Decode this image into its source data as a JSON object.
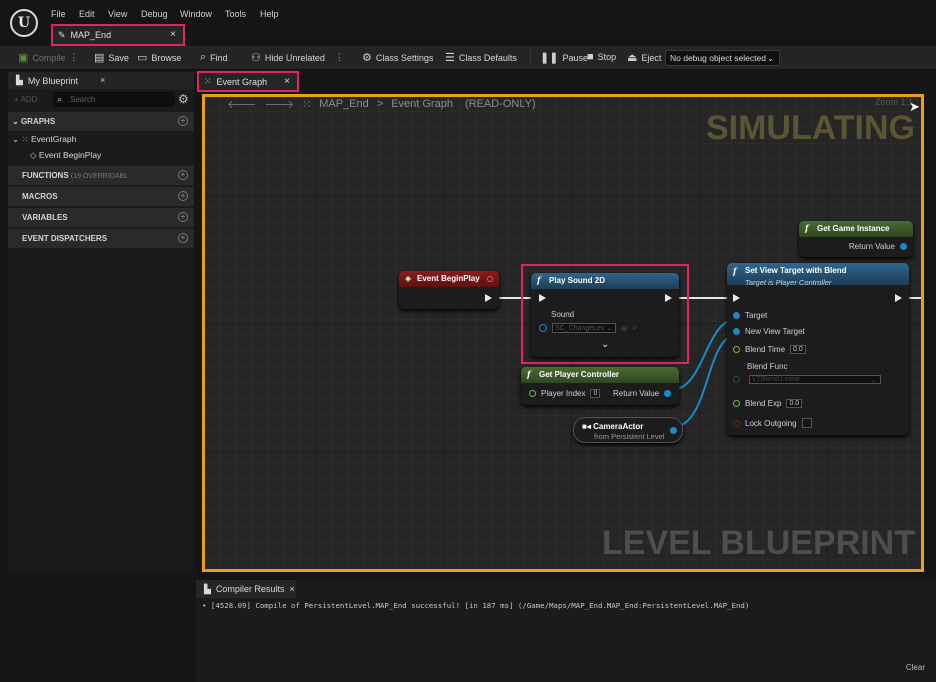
{
  "menu": [
    "File",
    "Edit",
    "View",
    "Debug",
    "Window",
    "Tools",
    "Help"
  ],
  "doc_tab": {
    "label": "MAP_End",
    "close": "×"
  },
  "toolbar": {
    "compile": "Compile",
    "save": "Save",
    "browse": "Browse",
    "find": "Find",
    "hide_unrelated": "Hide Unrelated",
    "class_settings": "Class Settings",
    "class_defaults": "Class Defaults",
    "pause": "Pause",
    "stop": "Stop",
    "eject": "Eject",
    "debug_select": "No debug object selected"
  },
  "left_panel": {
    "tab_label": "My Blueprint",
    "tab_close": "×",
    "add": "+ ADD",
    "search_placeholder": "Search",
    "sections": {
      "graphs": "GRAPHS",
      "functions": "FUNCTIONS",
      "functions_sub": "(19 OVERRIDABL",
      "macros": "MACROS",
      "variables": "VARIABLES",
      "dispatchers": "EVENT DISPATCHERS"
    },
    "tree": {
      "event_graph": "EventGraph",
      "event_begin_play": "Event BeginPlay"
    }
  },
  "graph_tab": {
    "label": "Event Graph",
    "close": "×"
  },
  "graph": {
    "breadcrumb_root": "MAP_End",
    "breadcrumb_sep": ">",
    "breadcrumb_graph": "Event Graph",
    "read_only": "(READ-ONLY)",
    "zoom": "Zoom 1:1",
    "watermark_top": "SIMULATING",
    "watermark_bottom": "LEVEL BLUEPRINT",
    "nodes": {
      "begin_play": {
        "title": "Event BeginPlay"
      },
      "play_sound": {
        "title": "Play Sound 2D",
        "pin_sound": "Sound",
        "sound_value": "SC_ChangeLev"
      },
      "get_player_controller": {
        "title": "Get Player Controller",
        "pin_index": "Player Index",
        "index_value": "0",
        "pin_return": "Return Value"
      },
      "camera_actor": {
        "title": "CameraActor",
        "subtitle": "from Persistent Level"
      },
      "get_game_instance": {
        "title": "Get Game Instance",
        "pin_return": "Return Value"
      },
      "set_view_target": {
        "title": "Set View Target with Blend",
        "subtitle": "Target is Player Controller",
        "pin_target": "Target",
        "pin_new_view_target": "New View Target",
        "pin_blend_time": "Blend Time",
        "blend_time_value": "0.0",
        "pin_blend_func": "Blend Func",
        "blend_func_value": "VTBlend Linear",
        "pin_blend_exp": "Blend Exp",
        "blend_exp_value": "0.0",
        "pin_lock_outgoing": "Lock Outgoing"
      }
    }
  },
  "compiler": {
    "tab_label": "Compiler Results",
    "tab_close": "×",
    "message": "• [4528.09] Compile of PersistentLevel.MAP_End successful! [in 187 ms] (/Game/Maps/MAP_End.MAP_End:PersistentLevel.MAP_End)",
    "clear": "Clear"
  },
  "colors": {
    "highlight": "#e0245e",
    "simulating_border": "#e89f1a",
    "event_node": "#8a1c1c",
    "function_node": "#2d5f86",
    "pure_node": "#3d5a2c"
  }
}
